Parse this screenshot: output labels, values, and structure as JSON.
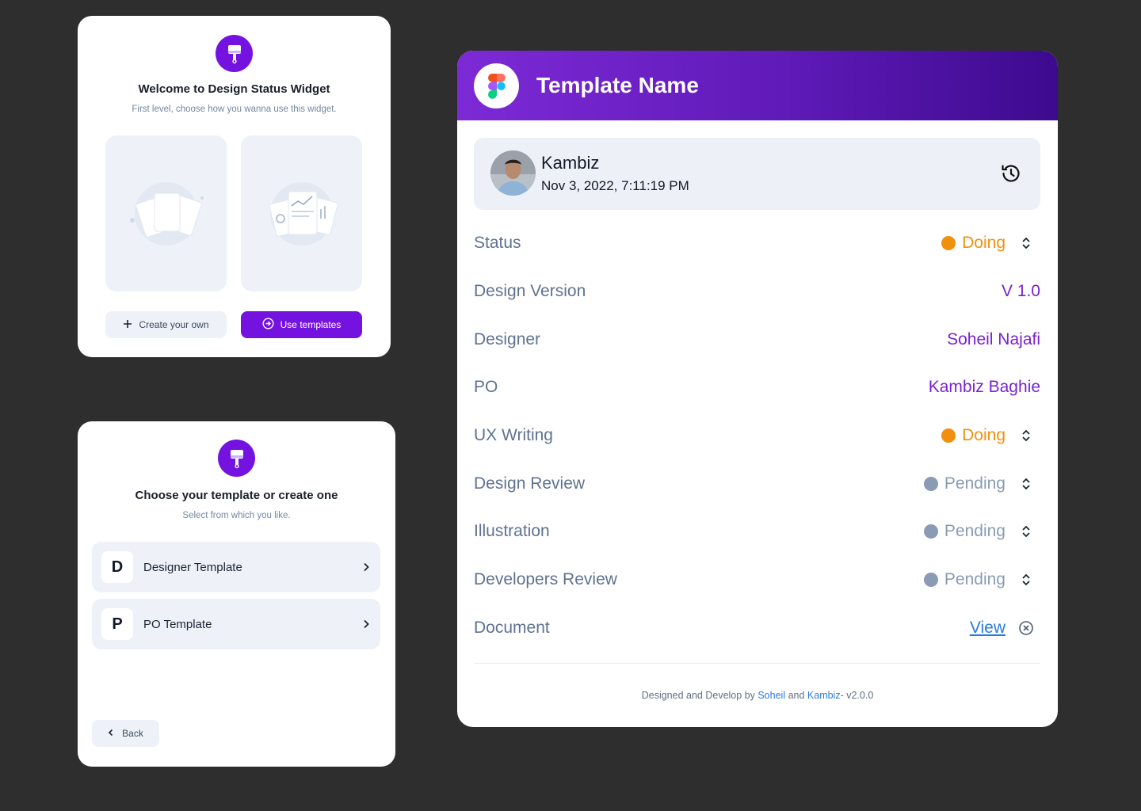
{
  "welcome": {
    "title": "Welcome to Design Status Widget",
    "subtitle": "First level, choose how you wanna use this widget.",
    "create_label": "Create your own",
    "use_label": "Use templates"
  },
  "choose": {
    "title": "Choose your template or create one",
    "subtitle": "Select from which you like.",
    "templates": [
      {
        "letter": "D",
        "label": "Designer Template"
      },
      {
        "letter": "P",
        "label": "PO Template"
      }
    ],
    "back_label": "Back"
  },
  "status_card": {
    "title": "Template Name",
    "user": {
      "name": "Kambiz",
      "date": "Nov 3, 2022, 7:11:19 PM"
    },
    "rows": [
      {
        "label": "Status",
        "value": "Doing",
        "kind": "doing"
      },
      {
        "label": "Design Version",
        "value": "V 1.0",
        "kind": "text"
      },
      {
        "label": "Designer",
        "value": "Soheil Najafi",
        "kind": "text"
      },
      {
        "label": "PO",
        "value": "Kambiz Baghie",
        "kind": "text"
      },
      {
        "label": "UX Writing",
        "value": "Doing",
        "kind": "doing"
      },
      {
        "label": "Design Review",
        "value": "Pending",
        "kind": "pending"
      },
      {
        "label": "Illustration",
        "value": "Pending",
        "kind": "pending"
      },
      {
        "label": "Developers Review",
        "value": "Pending",
        "kind": "pending"
      },
      {
        "label": "Document",
        "value": "View",
        "kind": "link"
      }
    ],
    "footer": {
      "prefix": "Designed and Develop by ",
      "author1": "Soheil",
      "and": " and ",
      "author2": "Kambiz",
      "version": "- v2.0.0"
    }
  },
  "colors": {
    "accent": "#7412e0",
    "doing": "#f1900f",
    "pending": "#8a9bb4",
    "link": "#2a7be0",
    "value_purple": "#7a22d3"
  },
  "icons": {
    "badge": "paint-brush-icon",
    "history": "history-icon",
    "sort": "sort-updown-icon",
    "close": "close-circle-icon",
    "chevron": "chevron-right-icon",
    "logo": "figma-logo-icon"
  }
}
